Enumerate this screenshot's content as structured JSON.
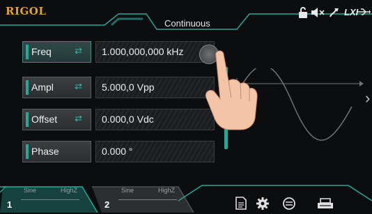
{
  "header": {
    "brand": "RIGOL",
    "mode": "Continuous",
    "icons": [
      "lock-icon",
      "mute-icon",
      "sync-icon",
      "lxi-icon",
      "usb-icon"
    ],
    "lxi_text": "LXI"
  },
  "params": [
    {
      "label": "Freq",
      "value": "1.000,000,000 kHz",
      "active": true,
      "linked": true
    },
    {
      "label": "Ampl",
      "value": "5.000,0 Vpp",
      "active": false,
      "linked": true
    },
    {
      "label": "Offset",
      "value": "0.000,0 Vdc",
      "active": false,
      "linked": true
    },
    {
      "label": "Phase",
      "value": "0.000 °",
      "active": false,
      "linked": false
    }
  ],
  "link_glyph": "⇄",
  "channels": [
    {
      "number": "1",
      "wave": "Sine",
      "impedance": "HighZ",
      "selected": true
    },
    {
      "number": "2",
      "wave": "Sine",
      "impedance": "HighZ",
      "selected": false
    }
  ],
  "bottom_icons": [
    "store-icon",
    "utility-icon",
    "help-icon",
    "print-icon"
  ],
  "colors": {
    "accent": "#23a99a",
    "brand": "#e6a327",
    "background": "#0c0d0e"
  }
}
